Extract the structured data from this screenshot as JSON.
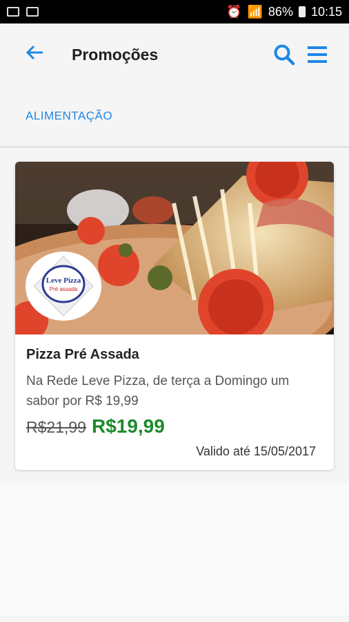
{
  "status": {
    "battery": "86%",
    "time": "10:15"
  },
  "appbar": {
    "title": "Promoções",
    "back_icon": "arrow-left-icon",
    "search_icon": "search-icon",
    "menu_icon": "menu-icon",
    "accent": "#1e88e5"
  },
  "tabs": [
    {
      "label": "ALIMENTAÇÃO"
    }
  ],
  "promo": {
    "title": "Pizza Pré Assada",
    "description": "Na Rede Leve Pizza, de terça a Domingo um sabor por R$ 19,99",
    "old_price": "R$21,99",
    "new_price": "R$19,99",
    "valid": "Valido até 15/05/2017",
    "logo": {
      "line1": "Leve Pizza",
      "line2": "Pré assada"
    },
    "price_color": "#1b8a2a"
  }
}
